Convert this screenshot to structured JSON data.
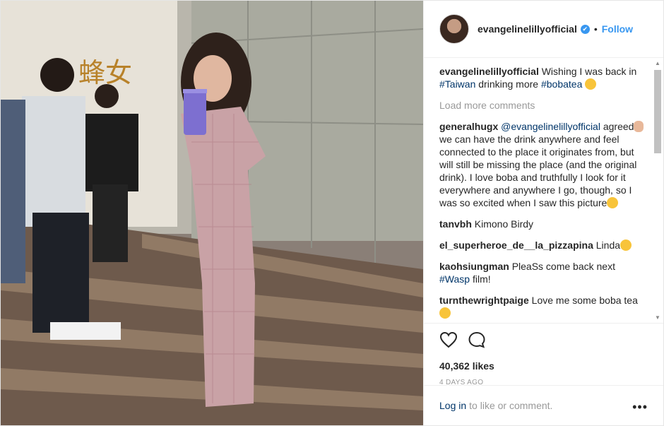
{
  "post": {
    "username": "evangelinelillyofficial",
    "verified_mark": "✔",
    "separator": "•",
    "follow_label": "Follow",
    "caption": {
      "username": "evangelinelillyofficial",
      "text_before": "Wishing I was back in ",
      "tag1": "#Taiwan",
      "text_middle": " drinking more ",
      "tag2": "#bobatea"
    },
    "load_more_label": "Load more comments",
    "comments": [
      {
        "username": "generalhugx",
        "mention": "@evangelinelillyofficial",
        "text_a": "agreed",
        "text_b": " we can have the drink anywhere and feel connected to the place it originates from, but will still be missing the place (and the original drink). I love boba and truthfully I look for it everywhere and anywhere I go, though, so I was so excited when I saw this picture"
      },
      {
        "username": "tanvbh",
        "text": "Kimono Birdy"
      },
      {
        "username": "el_superheroe_de__la_pizzapina",
        "text": "Linda"
      },
      {
        "username": "kaohsiungman",
        "text": "PleaSs come back next ",
        "tag": "#Wasp",
        "text_after": " film!"
      },
      {
        "username": "turnthewrightpaige",
        "text": "Love me some boba tea"
      }
    ],
    "likes": "40,362 likes",
    "time_ago": "4 DAYS AGO",
    "login_label": "Log in",
    "login_suffix": "to like or comment.",
    "more_options": "•••"
  },
  "icons": [
    "heart-icon",
    "comment-icon",
    "more-options-icon"
  ],
  "colors": {
    "accent": "#3897f0",
    "link": "#003569",
    "muted": "#999999",
    "text": "#262626"
  }
}
